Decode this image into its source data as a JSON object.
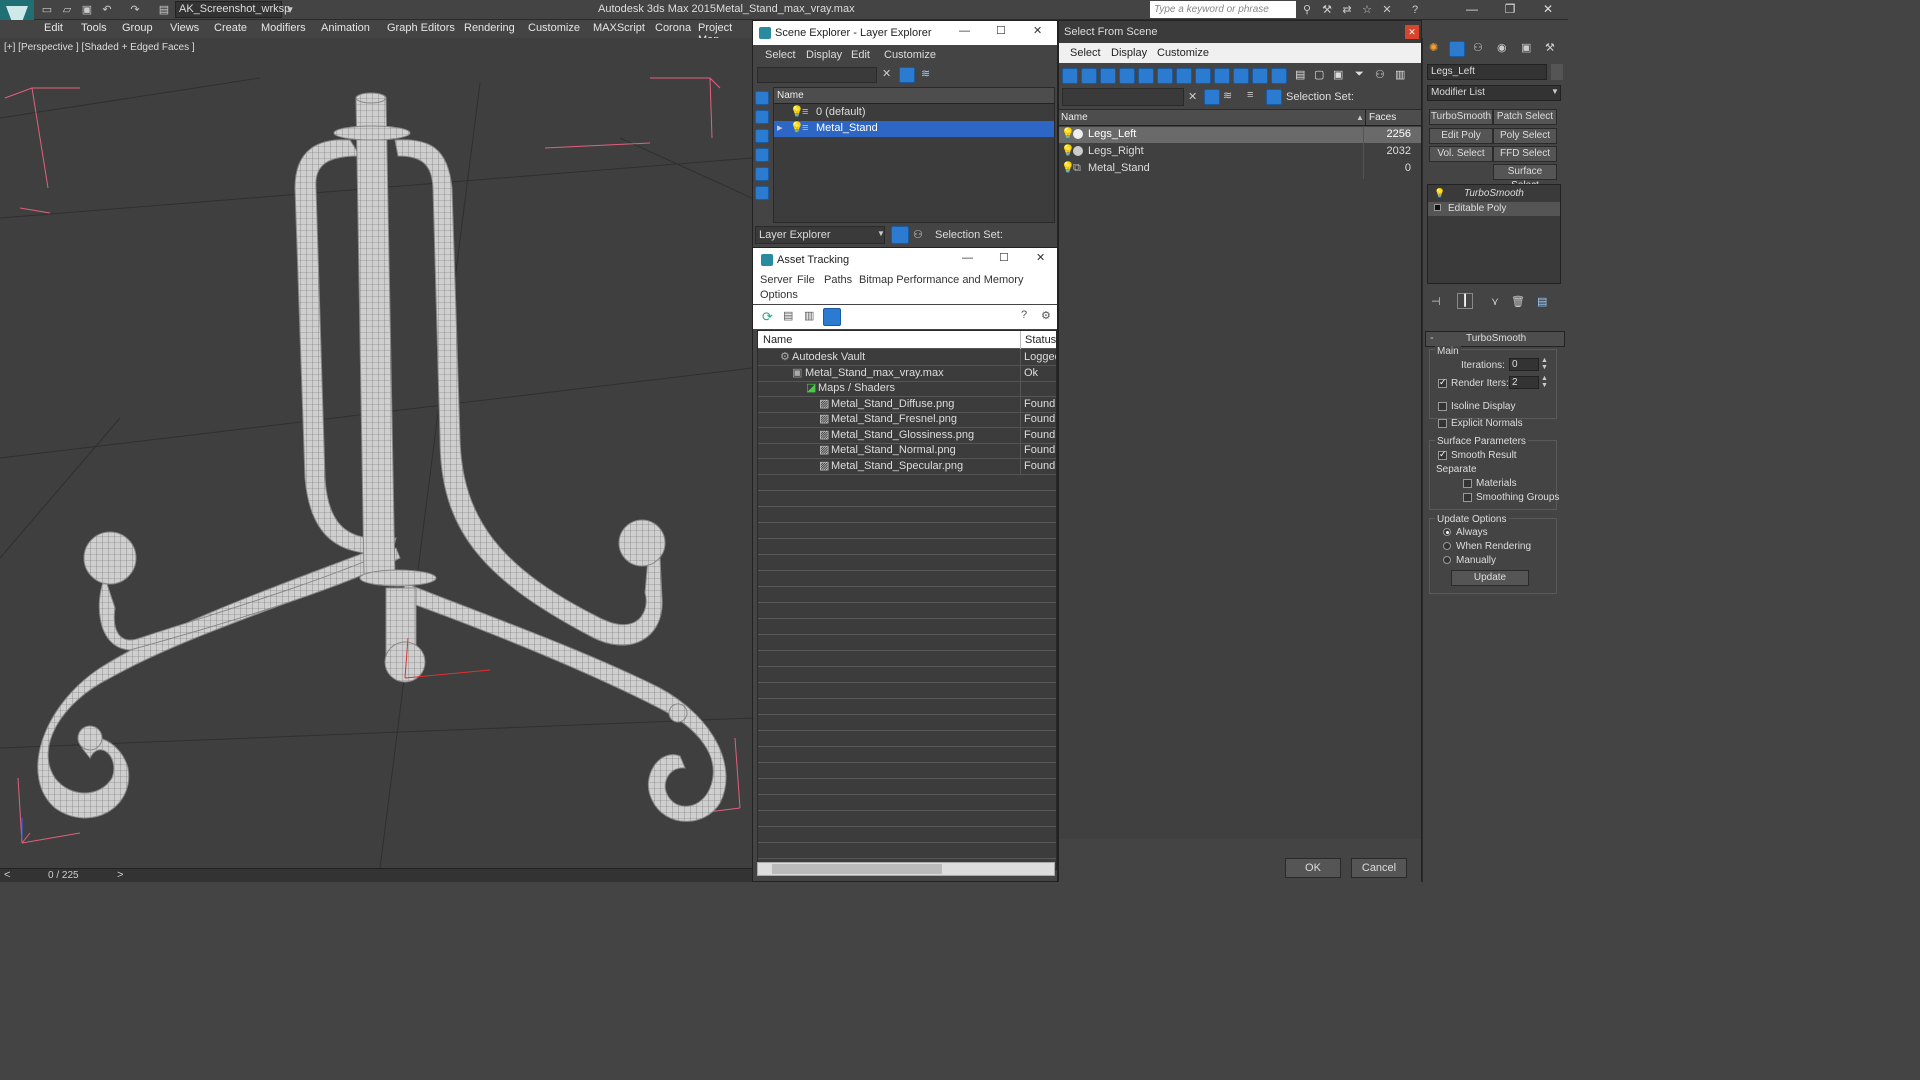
{
  "titlebar": {
    "workspace": "AK_Screenshot_wrksp",
    "app_title": "Autodesk 3ds Max  2015",
    "file_title": "Metal_Stand_max_vray.max",
    "search_placeholder": "Type a keyword or phrase",
    "min": "—",
    "max": "❐",
    "close": "✕"
  },
  "menubar": {
    "items": [
      "Edit",
      "Tools",
      "Group",
      "Views",
      "Create",
      "Modifiers",
      "Animation",
      "Graph Editors",
      "Rendering",
      "Customize",
      "MAXScript",
      "Corona",
      "Project Man"
    ]
  },
  "viewport": {
    "label": "[+] [Perspective ] [Shaded + Edged Faces ]"
  },
  "timeline": {
    "frame": "0 / 225",
    "prev": "<",
    "next": ">"
  },
  "scene_explorer": {
    "title": "Scene Explorer - Layer Explorer",
    "menus": [
      "Select",
      "Display",
      "Edit",
      "Customize"
    ],
    "col_name": "Name",
    "rows": [
      "0 (default)",
      "Metal_Stand"
    ],
    "footer_dropdown": "Layer Explorer",
    "selection_set": "Selection Set:"
  },
  "asset_tracking": {
    "title": "Asset Tracking",
    "menus": [
      "Server",
      "File",
      "Paths",
      "Bitmap Performance and Memory"
    ],
    "menu2": "Options",
    "col_name": "Name",
    "col_status": "Status",
    "rows": [
      {
        "name": "Autodesk Vault",
        "status": "Logged"
      },
      {
        "name": "Metal_Stand_max_vray.max",
        "status": "Ok"
      },
      {
        "name": "Maps / Shaders",
        "status": ""
      },
      {
        "name": "Metal_Stand_Diffuse.png",
        "status": "Found"
      },
      {
        "name": "Metal_Stand_Fresnel.png",
        "status": "Found"
      },
      {
        "name": "Metal_Stand_Glossiness.png",
        "status": "Found"
      },
      {
        "name": "Metal_Stand_Normal.png",
        "status": "Found"
      },
      {
        "name": "Metal_Stand_Specular.png",
        "status": "Found"
      }
    ]
  },
  "select_from_scene": {
    "title": "Select From Scene",
    "menus": [
      "Select",
      "Display",
      "Customize"
    ],
    "selection_set": "Selection Set:",
    "col_name": "Name",
    "col_faces": "Faces",
    "rows": [
      {
        "name": "Legs_Left",
        "faces": "2256"
      },
      {
        "name": "Legs_Right",
        "faces": "2032"
      },
      {
        "name": "Metal_Stand",
        "faces": "0"
      }
    ],
    "ok": "OK",
    "cancel": "Cancel"
  },
  "command_panel": {
    "object_name": "Legs_Left",
    "modifier_list": "Modifier List",
    "buttons": [
      "TurboSmooth",
      "Patch Select",
      "Edit Poly",
      "Poly Select",
      "Vol. Select",
      "FFD Select",
      "Surface Select"
    ],
    "stack": [
      "TurboSmooth",
      "Editable Poly"
    ],
    "rollout_title": "TurboSmooth",
    "main": "Main",
    "iterations_label": "Iterations:",
    "iterations": "0",
    "render_iters_label": "Render Iters:",
    "render_iters": "2",
    "isoline": "Isoline Display",
    "explicit_normals": "Explicit Normals",
    "surface_params": "Surface Parameters",
    "smooth_result": "Smooth Result",
    "separate": "Separate",
    "materials": "Materials",
    "smoothing_groups": "Smoothing Groups",
    "update_options": "Update Options",
    "always": "Always",
    "when_rendering": "When Rendering",
    "manually": "Manually",
    "update": "Update"
  }
}
